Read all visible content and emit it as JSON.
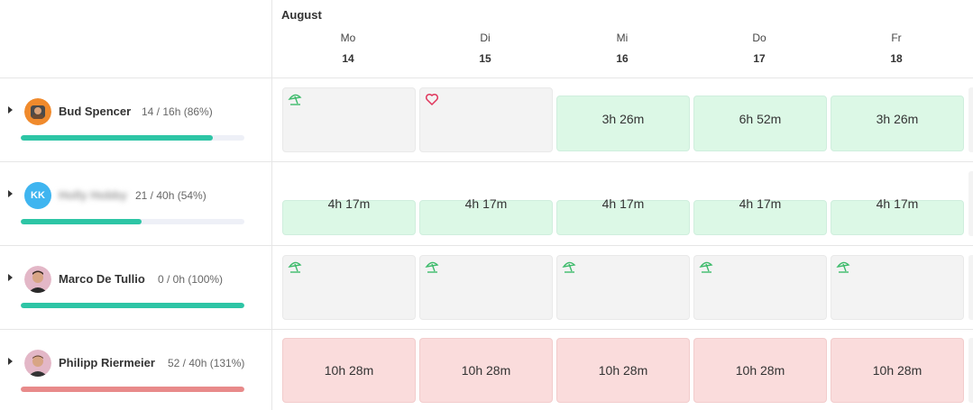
{
  "header": {
    "month": "August",
    "days": [
      {
        "name": "Mo",
        "num": "14"
      },
      {
        "name": "Di",
        "num": "15"
      },
      {
        "name": "Mi",
        "num": "16"
      },
      {
        "name": "Do",
        "num": "17"
      },
      {
        "name": "Fr",
        "num": "18"
      }
    ]
  },
  "people": [
    {
      "name": "Bud Spencer",
      "hours": "14 / 16h (86%)",
      "progress": 0.86,
      "bar_color": "#2dc5a5",
      "cells": [
        {
          "kind": "gray",
          "icon": "umbrella-icon",
          "label": ""
        },
        {
          "kind": "gray",
          "icon": "heart-icon",
          "label": ""
        },
        {
          "kind": "green",
          "icon": "",
          "label": "3h 26m"
        },
        {
          "kind": "green",
          "icon": "",
          "label": "6h 52m"
        },
        {
          "kind": "green",
          "icon": "",
          "label": "3h 26m"
        }
      ]
    },
    {
      "name": "Holly Hobby",
      "initials": "KK",
      "hours": "21 / 40h (54%)",
      "progress": 0.54,
      "bar_color": "#2dc5a5",
      "cells": [
        {
          "kind": "green",
          "icon": "",
          "label": "4h 17m"
        },
        {
          "kind": "green",
          "icon": "",
          "label": "4h 17m"
        },
        {
          "kind": "green",
          "icon": "",
          "label": "4h 17m"
        },
        {
          "kind": "green",
          "icon": "",
          "label": "4h 17m"
        },
        {
          "kind": "green",
          "icon": "",
          "label": "4h 17m"
        }
      ]
    },
    {
      "name": "Marco De Tullio",
      "hours": "0 / 0h (100%)",
      "progress": 1.0,
      "bar_color": "#2dc5a5",
      "cells": [
        {
          "kind": "gray",
          "icon": "umbrella-icon",
          "label": ""
        },
        {
          "kind": "gray",
          "icon": "umbrella-icon",
          "label": ""
        },
        {
          "kind": "gray",
          "icon": "umbrella-icon",
          "label": ""
        },
        {
          "kind": "gray",
          "icon": "umbrella-icon",
          "label": ""
        },
        {
          "kind": "gray",
          "icon": "umbrella-icon",
          "label": ""
        }
      ]
    },
    {
      "name": "Philipp Riermeier",
      "hours": "52 / 40h (131%)",
      "progress": 1.31,
      "bar_color": "#e88a8a",
      "cells": [
        {
          "kind": "red",
          "icon": "",
          "label": "10h 28m"
        },
        {
          "kind": "red",
          "icon": "",
          "label": "10h 28m"
        },
        {
          "kind": "red",
          "icon": "",
          "label": "10h 28m"
        },
        {
          "kind": "red",
          "icon": "",
          "label": "10h 28m"
        },
        {
          "kind": "red",
          "icon": "",
          "label": "10h 28m"
        }
      ]
    }
  ],
  "colors": {
    "green_cell": "#dcf8e6",
    "red_cell": "#fadcdc",
    "gray_cell": "#f3f3f3",
    "umbrella_icon": "#3dbb6b",
    "heart_icon": "#e0345a"
  }
}
